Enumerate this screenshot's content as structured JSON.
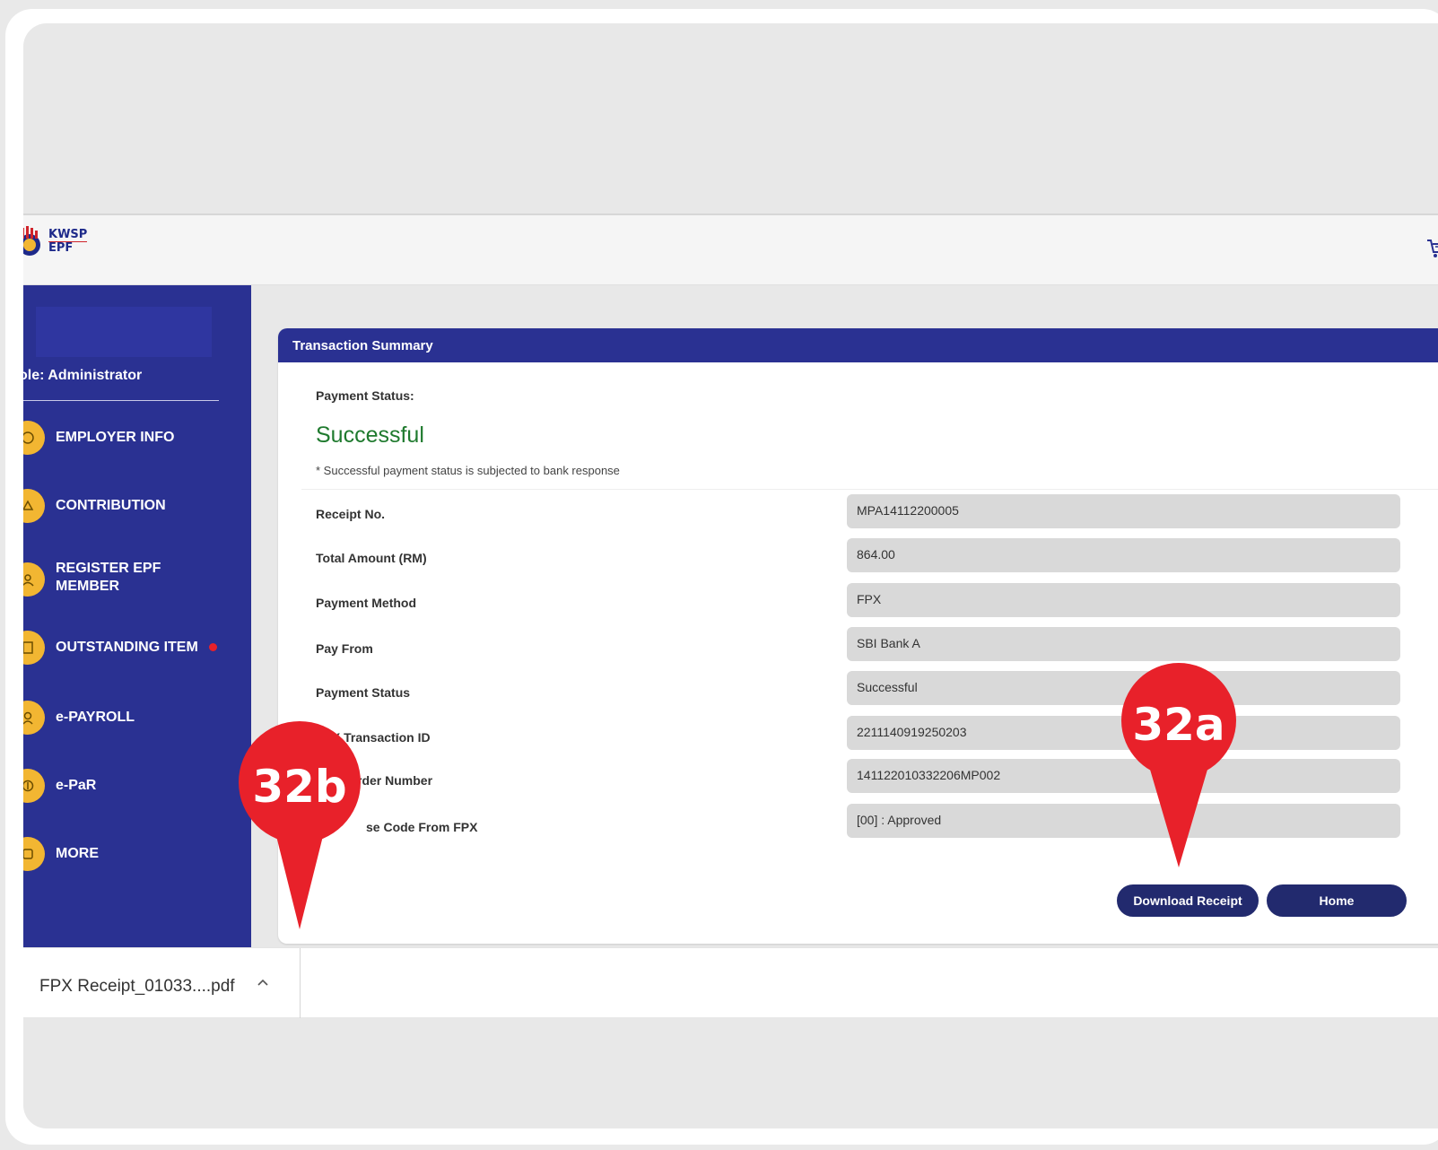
{
  "header": {
    "logo_line1": "KWSP",
    "logo_line2": "EPF",
    "cart_icon": "cart-icon"
  },
  "sidebar": {
    "role": "ole: Administrator",
    "items": [
      {
        "label": "EMPLOYER INFO",
        "icon": "employer-icon"
      },
      {
        "label": "CONTRIBUTION",
        "icon": "contribution-icon"
      },
      {
        "label": "REGISTER EPF",
        "label2": "MEMBER",
        "icon": "register-member-icon"
      },
      {
        "label": "OUTSTANDING ITEM",
        "icon": "outstanding-icon",
        "alert": true
      },
      {
        "label": "e-PAYROLL",
        "icon": "payroll-icon"
      },
      {
        "label": "e-PaR",
        "icon": "epar-icon"
      },
      {
        "label": "MORE",
        "icon": "more-icon"
      }
    ]
  },
  "summary": {
    "title": "Transaction Summary",
    "payment_status_label": "Payment Status:",
    "payment_status_value": "Successful",
    "note": "* Successful payment status is subjected to bank response",
    "rows": [
      {
        "label": "Receipt No.",
        "value": "MPA14112200005"
      },
      {
        "label": "Total Amount (RM)",
        "value": "864.00"
      },
      {
        "label": "Payment Method",
        "value": "FPX"
      },
      {
        "label": "Pay From",
        "value": "SBI Bank A"
      },
      {
        "label": "Payment Status",
        "value": "Successful"
      },
      {
        "label": "FPX Transaction ID",
        "value": "2211140919250203"
      },
      {
        "label": "rder Number",
        "value": "141122010332206MP002"
      },
      {
        "label": "se Code From FPX",
        "value": "[00] : Approved"
      }
    ],
    "download_button": "Download Receipt",
    "home_button": "Home"
  },
  "download_bar": {
    "file_name": "FPX Receipt_01033....pdf"
  },
  "annotations": {
    "marker_a": "32a",
    "marker_b": "32b",
    "color": "#e8212a"
  },
  "colors": {
    "brand_navy": "#2a3192",
    "button_navy": "#222a6e",
    "success_green": "#1f7a2e",
    "nav_icon_gold": "#f2b632"
  }
}
